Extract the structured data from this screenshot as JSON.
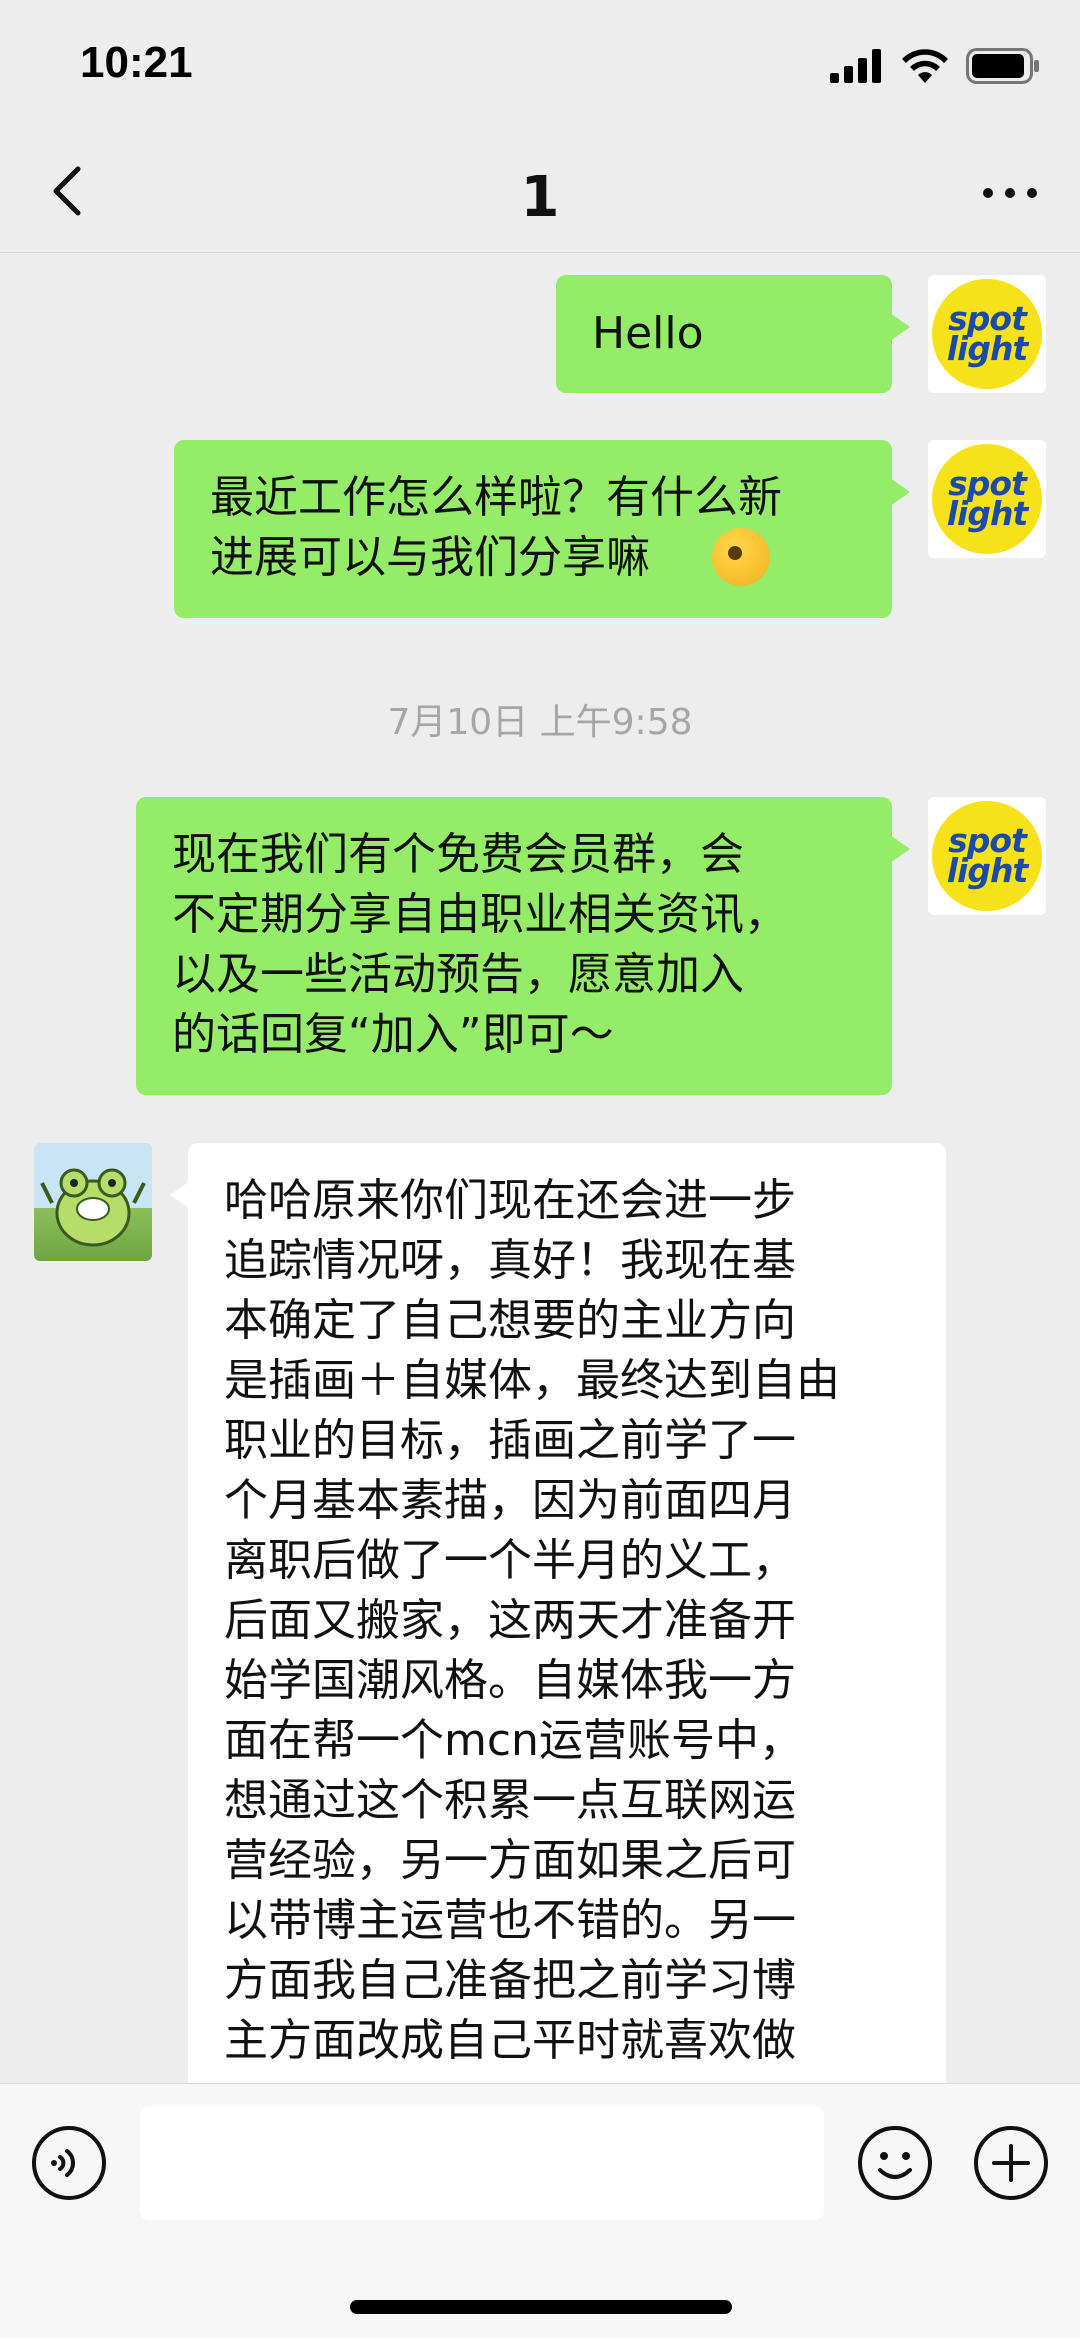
{
  "status_bar": {
    "time": "10:21"
  },
  "nav": {
    "title": "1"
  },
  "messages": [
    {
      "side": "right",
      "sender": "spotlight",
      "text": "Hello"
    },
    {
      "side": "right",
      "sender": "spotlight",
      "text": "最近工作怎么样啦？有什么新\n进展可以与我们分享嘛"
    },
    {
      "type": "timestamp",
      "text": "7月10日 上午9:58"
    },
    {
      "side": "right",
      "sender": "spotlight",
      "text": "现在我们有个免费会员群，会\n不定期分享自由职业相关资讯，\n以及一些活动预告，愿意加入\n的话回复“加入”即可～"
    },
    {
      "side": "left",
      "sender": "frog",
      "text": "哈哈原来你们现在还会进一步\n追踪情况呀，真好！我现在基\n本确定了自己想要的主业方向\n是插画＋自媒体，最终达到自由\n职业的目标，插画之前学了一\n个月基本素描，因为前面四月\n离职后做了一个半月的义工，\n后面又搬家，这两天才准备开\n始学国潮风格。自媒体我一方\n面在帮一个mcn运营账号中，\n想通过这个积累一点互联网运\n营经验，另一方面如果之后可\n以带博主运营也不错的。另一\n方面我自己准备把之前学习博\n主方面改成自己平时就喜欢做"
    }
  ],
  "avatars": {
    "spotlight": {
      "line1": "spot",
      "line2": "light",
      "bg_color": "#f7e21a",
      "text_color": "#1c4aa8"
    },
    "frog": {
      "icon": "frog-avatar-icon"
    }
  },
  "input_bar": {
    "placeholder": ""
  },
  "colors": {
    "bubble_green": "#95ec69",
    "bubble_white": "#ffffff",
    "background": "#ededed"
  }
}
